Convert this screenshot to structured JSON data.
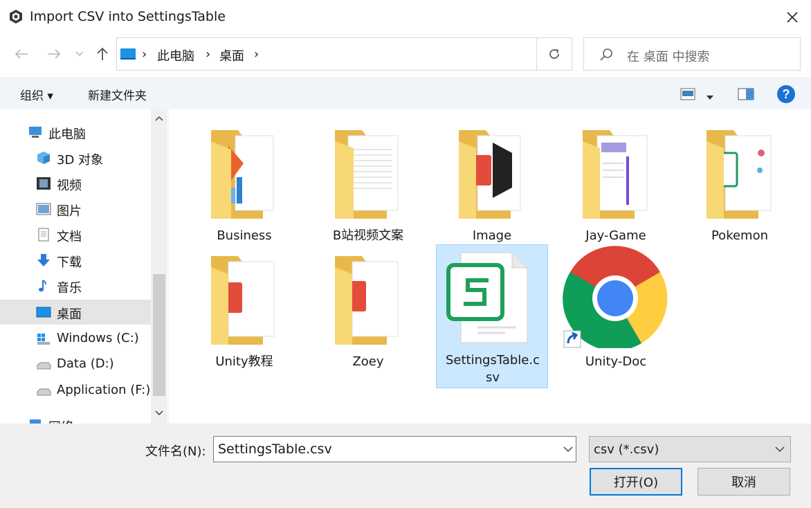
{
  "window": {
    "title": "Import CSV into SettingsTable"
  },
  "address": {
    "crumbs": [
      "此电脑",
      "桌面"
    ]
  },
  "search": {
    "placeholder": "在 桌面 中搜索"
  },
  "toolbar": {
    "organize_label": "组织 ▾",
    "new_folder_label": "新建文件夹"
  },
  "sidebar": {
    "items": [
      {
        "label": "此电脑",
        "icon": "pc-icon"
      },
      {
        "label": "3D 对象",
        "icon": "cube-icon"
      },
      {
        "label": "视频",
        "icon": "video-icon"
      },
      {
        "label": "图片",
        "icon": "picture-icon"
      },
      {
        "label": "文档",
        "icon": "document-icon"
      },
      {
        "label": "下载",
        "icon": "download-icon"
      },
      {
        "label": "音乐",
        "icon": "music-icon"
      },
      {
        "label": "桌面",
        "icon": "desktop-icon",
        "selected": true
      },
      {
        "label": "Windows (C:)",
        "icon": "drive-icon"
      },
      {
        "label": "Data (D:)",
        "icon": "drive-icon"
      },
      {
        "label": "Application (F:)",
        "icon": "drive-icon"
      },
      {
        "label": "网络",
        "icon": "network-icon"
      }
    ]
  },
  "files": [
    {
      "name": "Business",
      "type": "folder"
    },
    {
      "name": "B站视频文案",
      "type": "folder"
    },
    {
      "name": "Image",
      "type": "folder"
    },
    {
      "name": "Jay-Game",
      "type": "folder"
    },
    {
      "name": "Pokemon",
      "type": "folder"
    },
    {
      "name": "Unity教程",
      "type": "folder"
    },
    {
      "name": "Zoey",
      "type": "folder"
    },
    {
      "name": "SettingsTable.c",
      "name2": "sv",
      "type": "csv",
      "selected": true
    },
    {
      "name": "Unity-Doc",
      "type": "shortcut"
    }
  ],
  "footer": {
    "filename_label": "文件名(N):",
    "filename_value": "SettingsTable.csv",
    "filetype_value": "csv (*.csv)",
    "open_label": "打开(O)",
    "cancel_label": "取消"
  },
  "colors": {
    "accent": "#0078d7",
    "folder": "#f8d775",
    "selection": "#cce8ff"
  }
}
